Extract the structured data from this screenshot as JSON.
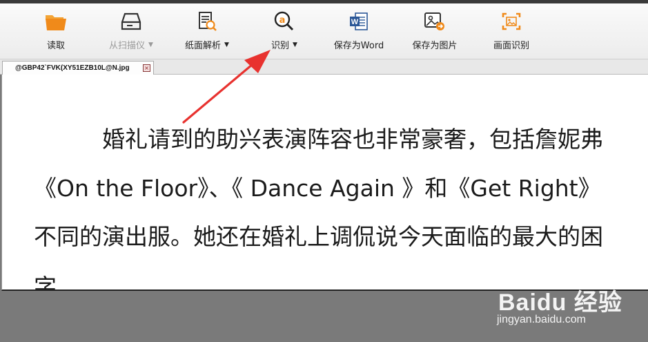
{
  "toolbar": {
    "items": [
      {
        "label": "读取",
        "icon": "folder-icon",
        "caret": false,
        "disabled": false
      },
      {
        "label": "从扫描仪",
        "icon": "scanner-icon",
        "caret": true,
        "disabled": true
      },
      {
        "label": "纸面解析",
        "icon": "document-search-icon",
        "caret": true,
        "disabled": false
      },
      {
        "label": "识别",
        "icon": "ocr-recognize-icon",
        "caret": true,
        "disabled": false
      },
      {
        "label": "保存为Word",
        "icon": "word-icon",
        "caret": false,
        "disabled": false
      },
      {
        "label": "保存为图片",
        "icon": "save-image-icon",
        "caret": false,
        "disabled": false
      },
      {
        "label": "画面识别",
        "icon": "screen-capture-icon",
        "caret": false,
        "disabled": false
      }
    ],
    "caret_glyph": "▼"
  },
  "tab": {
    "title": "@GBP42`FVK(XY51EZB10L@N.jpg",
    "close_glyph": "×"
  },
  "document": {
    "lines": [
      "婚礼请到的助兴表演阵容也非常豪奢，包括詹妮弗",
      "《On the Floor》、《 Dance Again 》和《Get Right》",
      "不同的演出服。她还在婚礼上调侃说今天面临的最大的困",
      "字。"
    ]
  },
  "watermark": {
    "logo": "Baidu 经验",
    "url": "jingyan.baidu.com"
  },
  "colors": {
    "accent_orange": "#f08a1a",
    "word_blue": "#2b5797",
    "arrow_red": "#e8322f"
  }
}
